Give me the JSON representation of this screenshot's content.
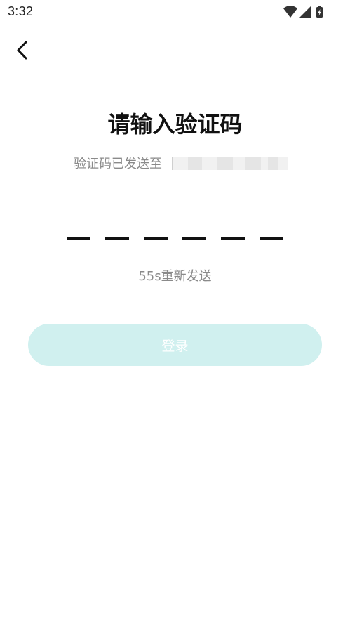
{
  "status_bar": {
    "time": "3:32"
  },
  "header": {
    "back_icon": "chevron-left-icon"
  },
  "main": {
    "title": "请输入验证码",
    "subtitle_prefix": "验证码已发送至",
    "code_length": 6,
    "resend_text": "55s重新发送",
    "login_label": "登录"
  },
  "colors": {
    "accent_disabled": "#d0f0ef",
    "muted_text": "#8a8a8a",
    "title_text": "#111111"
  }
}
